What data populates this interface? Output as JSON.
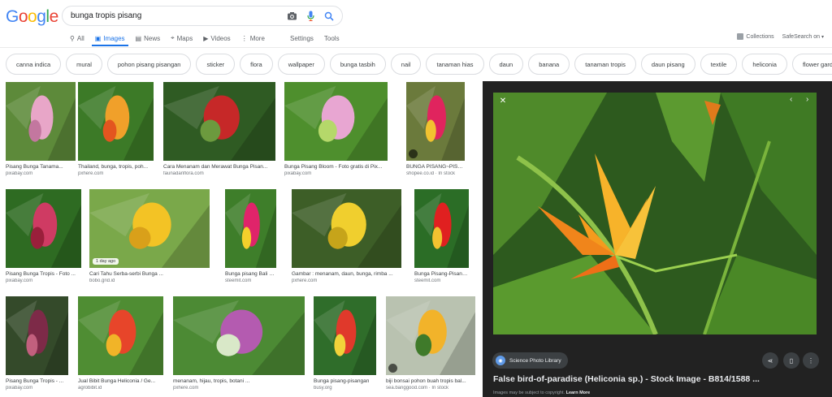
{
  "brand": {
    "letters": [
      {
        "ch": "G",
        "color": "#4285f4"
      },
      {
        "ch": "o",
        "color": "#ea4335"
      },
      {
        "ch": "o",
        "color": "#fbbc05"
      },
      {
        "ch": "g",
        "color": "#4285f4"
      },
      {
        "ch": "l",
        "color": "#34a853"
      },
      {
        "ch": "e",
        "color": "#ea4335"
      }
    ]
  },
  "search": {
    "query": "bunga tropis pisang"
  },
  "nav": {
    "tabs": [
      {
        "label": "All",
        "icon": "search-icon"
      },
      {
        "label": "Images",
        "icon": "image-icon",
        "active": true
      },
      {
        "label": "News",
        "icon": "news-icon"
      },
      {
        "label": "Maps",
        "icon": "map-pin-icon"
      },
      {
        "label": "Videos",
        "icon": "video-icon"
      },
      {
        "label": "More",
        "icon": "more-vert-icon"
      }
    ],
    "settings": "Settings",
    "tools": "Tools",
    "collections": "Collections",
    "safesearch": "SafeSearch on"
  },
  "chips": [
    "canna indica",
    "mural",
    "pohon pisang pisangan",
    "sticker",
    "flora",
    "wallpaper",
    "bunga tasbih",
    "nail",
    "tanaman hias",
    "daun",
    "banana",
    "tanaman tropis",
    "daun pisang",
    "textile",
    "heliconia",
    "flower garden"
  ],
  "results": [
    {
      "caption": "Pisang Bunga Tanama...",
      "source": "pixabay.com"
    },
    {
      "caption": "Thailand, bunga, tropis, poh...",
      "source": "pxhere.com"
    },
    {
      "caption": "Cara Menanam dan Merawat Bunga Pisan...",
      "source": "faunadanflora.com"
    },
    {
      "caption": "Bunga Pisang Bloom - Foto gratis di Pix...",
      "source": "pixabay.com"
    },
    {
      "caption": "BUNGA PISANG~PISANG P...",
      "source": "shopee.co.id · In stock"
    },
    {
      "caption": "Pisang Bunga Tropis - Foto ...",
      "source": "pixabay.com"
    },
    {
      "caption": "Cari Tahu Serba-serbi Bunga ...",
      "source": "bobo.grid.id",
      "badge": "1 day ago"
    },
    {
      "caption": "Bunga pisang Bali # C...",
      "source": "steemit.com"
    },
    {
      "caption": "Gambar : menanam, daun, bunga, rimba ...",
      "source": "pxhere.com"
    },
    {
      "caption": "Bunga Pisang-Pisanga...",
      "source": "steemit.com"
    },
    {
      "caption": "Pisang Bunga Tropis - ...",
      "source": "pixabay.com"
    },
    {
      "caption": "Jual Bibit Bunga Heliconia / Ge...",
      "source": "agrobibit.id"
    },
    {
      "caption": "menanam, hijau, tropis, botani ...",
      "source": "pxhere.com"
    },
    {
      "caption": "Bunga pisang-pisangan",
      "source": "busy.org"
    },
    {
      "caption": "biji bonsai pohon buah tropis bal...",
      "source": "sea.banggood.com · In stock"
    }
  ],
  "preview": {
    "source": "Science Photo Library",
    "title": "False bird-of-paradise (Heliconia sp.) - Stock Image - B814/1588 ...",
    "copyright": "Images may be subject to copyright.",
    "learn_more": "Learn More"
  },
  "colors": {
    "accent": "#1a73e8",
    "panel_bg": "#222222"
  }
}
